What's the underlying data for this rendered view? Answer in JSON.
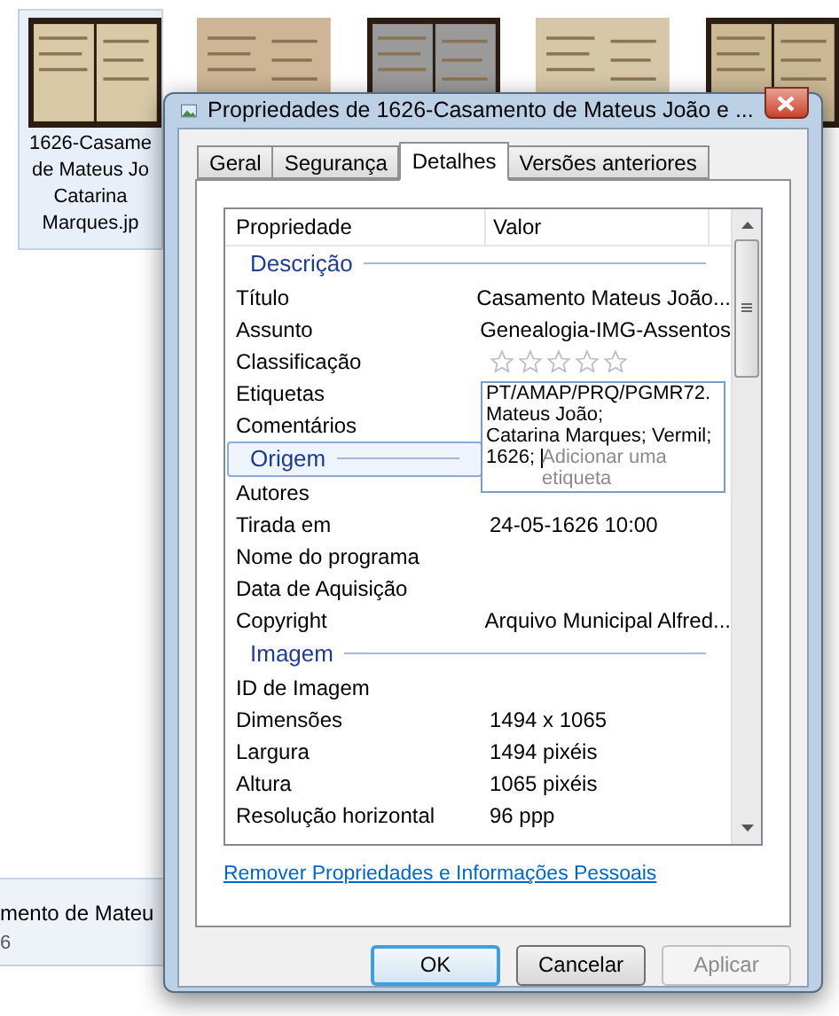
{
  "background": {
    "thumbnails": [
      {
        "kind": "picture"
      },
      {
        "kind": "picture"
      },
      {
        "kind": "picture"
      },
      {
        "kind": "picture"
      },
      {
        "kind": "picture"
      }
    ],
    "caption_lines": [
      "1626-Casame",
      "de Mateus Jo",
      "Catarina",
      "Marques.jp"
    ],
    "details_pane": [
      "mento de Mateu",
      "6"
    ]
  },
  "dialog": {
    "title": "Propriedades de 1626-Casamento de Mateus João e ...",
    "tabs": [
      {
        "label": "Geral",
        "selected": false
      },
      {
        "label": "Segurança",
        "selected": false
      },
      {
        "label": "Detalhes",
        "selected": true
      },
      {
        "label": "Versões anteriores",
        "selected": false
      }
    ],
    "columns": [
      "Propriedade",
      "Valor"
    ],
    "sections": [
      {
        "title": "Descrição",
        "selected": false,
        "rows": [
          {
            "kind": "text",
            "name": "Título",
            "value": "Casamento Mateus João..."
          },
          {
            "kind": "text",
            "name": "Assunto",
            "value": "Genealogia-IMG-Assentos"
          },
          {
            "kind": "stars",
            "name": "Classificação",
            "stars": 0
          },
          {
            "kind": "tags",
            "name": "Etiquetas",
            "lines": [
              "PT/AMAP/PRQ/PGMR72.",
              "Mateus João;",
              "Catarina Marques; Vermil;",
              "1626;"
            ],
            "placeholder": "Adicionar uma etiqueta"
          },
          {
            "kind": "text",
            "name": "Comentários",
            "value": ""
          }
        ]
      },
      {
        "title": "Origem",
        "selected": true,
        "rows": [
          {
            "kind": "text",
            "name": "Autores",
            "value": ""
          },
          {
            "kind": "text",
            "name": "Tirada em",
            "value": "24-05-1626 10:00"
          },
          {
            "kind": "text",
            "name": "Nome do programa",
            "value": ""
          },
          {
            "kind": "text",
            "name": "Data de Aquisição",
            "value": ""
          },
          {
            "kind": "text",
            "name": "Copyright",
            "value": "Arquivo Municipal Alfred..."
          }
        ]
      },
      {
        "title": "Imagem",
        "selected": false,
        "rows": [
          {
            "kind": "text",
            "name": "ID de Imagem",
            "value": ""
          },
          {
            "kind": "text",
            "name": "Dimensões",
            "value": "1494 x 1065"
          },
          {
            "kind": "text",
            "name": "Largura",
            "value": "1494 pixéis"
          },
          {
            "kind": "text",
            "name": "Altura",
            "value": "1065 pixéis"
          },
          {
            "kind": "text",
            "name": "Resolução horizontal",
            "value": "96 ppp"
          }
        ]
      }
    ],
    "link": "Remover Propriedades e Informações Pessoais",
    "buttons": [
      {
        "label": "OK",
        "default": true,
        "disabled": false
      },
      {
        "label": "Cancelar",
        "default": false,
        "disabled": false
      },
      {
        "label": "Aplicar",
        "default": false,
        "disabled": true
      }
    ]
  }
}
